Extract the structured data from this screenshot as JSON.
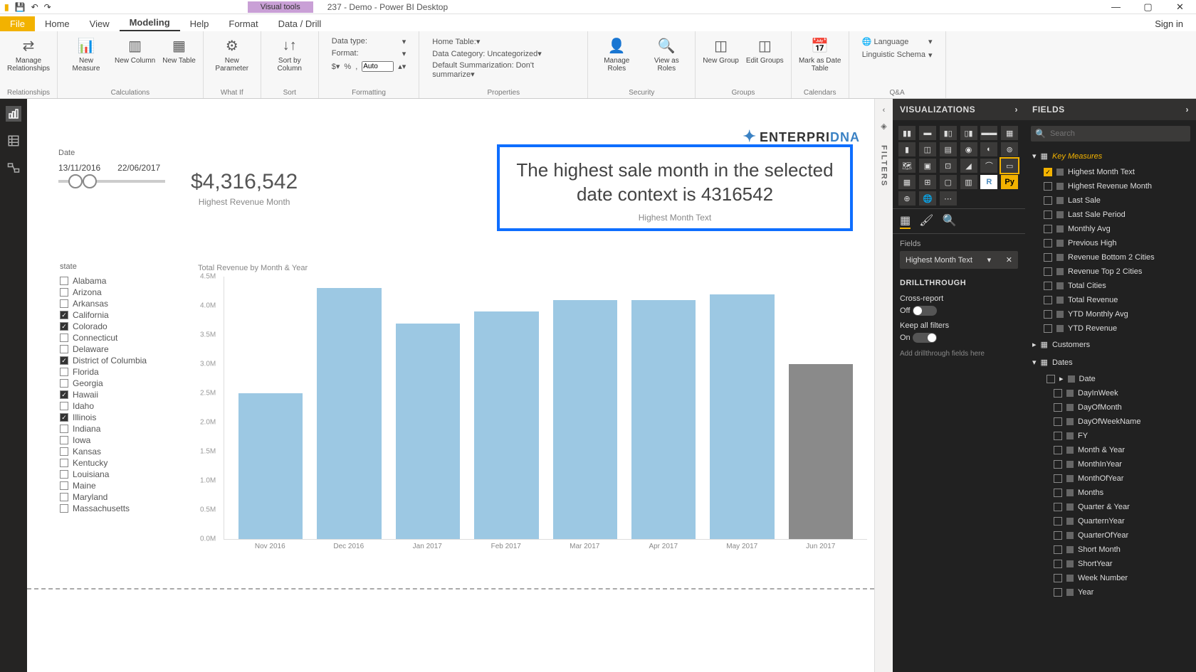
{
  "titlebar": {
    "title": "237 - Demo - Power BI Desktop",
    "vtools": "Visual tools",
    "signin": "Sign in"
  },
  "tabs": {
    "file": "File",
    "items": [
      "Home",
      "View",
      "Modeling",
      "Help",
      "Format",
      "Data / Drill"
    ],
    "active": "Modeling"
  },
  "ribbon": {
    "relationships": {
      "manage": "Manage\nRelationships",
      "group": "Relationships"
    },
    "calcs": {
      "measure": "New\nMeasure",
      "column": "New\nColumn",
      "table": "New\nTable",
      "group": "Calculations"
    },
    "whatif": {
      "param": "New\nParameter",
      "group": "What If"
    },
    "sort": {
      "btn": "Sort by\nColumn",
      "group": "Sort"
    },
    "formatting": {
      "datatype": "Data type:",
      "format": "Format:",
      "auto": "Auto",
      "group": "Formatting"
    },
    "props": {
      "hometable": "Home Table:",
      "datacat": "Data Category: Uncategorized",
      "summ": "Default Summarization: Don't summarize",
      "group": "Properties"
    },
    "security": {
      "manage": "Manage\nRoles",
      "view": "View as\nRoles",
      "group": "Security"
    },
    "groups": {
      "new": "New\nGroup",
      "edit": "Edit\nGroups",
      "group": "Groups"
    },
    "calendars": {
      "mark": "Mark as\nDate Table",
      "group": "Calendars"
    },
    "qa": {
      "lang": "Language",
      "ling": "Linguistic Schema",
      "group": "Q&A"
    }
  },
  "dateSlicer": {
    "label": "Date",
    "from": "13/11/2016",
    "to": "22/06/2017"
  },
  "card": {
    "value": "$4,316,542",
    "caption": "Highest Revenue Month"
  },
  "textVisual": {
    "text": "The highest sale month in the selected date context is 4316542",
    "caption": "Highest Month Text"
  },
  "states": {
    "label": "state",
    "items": [
      {
        "name": "Alabama",
        "checked": false
      },
      {
        "name": "Arizona",
        "checked": false
      },
      {
        "name": "Arkansas",
        "checked": false
      },
      {
        "name": "California",
        "checked": true
      },
      {
        "name": "Colorado",
        "checked": true
      },
      {
        "name": "Connecticut",
        "checked": false
      },
      {
        "name": "Delaware",
        "checked": false
      },
      {
        "name": "District of Columbia",
        "checked": true
      },
      {
        "name": "Florida",
        "checked": false
      },
      {
        "name": "Georgia",
        "checked": false
      },
      {
        "name": "Hawaii",
        "checked": true
      },
      {
        "name": "Idaho",
        "checked": false
      },
      {
        "name": "Illinois",
        "checked": true
      },
      {
        "name": "Indiana",
        "checked": false
      },
      {
        "name": "Iowa",
        "checked": false
      },
      {
        "name": "Kansas",
        "checked": false
      },
      {
        "name": "Kentucky",
        "checked": false
      },
      {
        "name": "Louisiana",
        "checked": false
      },
      {
        "name": "Maine",
        "checked": false
      },
      {
        "name": "Maryland",
        "checked": false
      },
      {
        "name": "Massachusetts",
        "checked": false
      }
    ]
  },
  "chart_data": {
    "type": "bar",
    "title": "Total Revenue by Month & Year",
    "ylabel": "",
    "xlabel": "",
    "ylim": [
      0,
      4500000
    ],
    "yticks": [
      "4.5M",
      "4.0M",
      "3.5M",
      "3.0M",
      "2.5M",
      "2.0M",
      "1.5M",
      "1.0M",
      "0.5M",
      "0.0M"
    ],
    "categories": [
      "Nov 2016",
      "Dec 2016",
      "Jan 2017",
      "Feb 2017",
      "Mar 2017",
      "Apr 2017",
      "May 2017",
      "Jun 2017"
    ],
    "values": [
      2500000,
      4300000,
      3700000,
      3900000,
      4100000,
      4100000,
      4200000,
      3000000
    ],
    "dimmed": [
      false,
      false,
      false,
      false,
      false,
      false,
      false,
      true
    ]
  },
  "logo": {
    "a": "ENTERPRI",
    "b": "DNA"
  },
  "vizPanel": {
    "header": "VISUALIZATIONS",
    "fieldsLabel": "Fields",
    "well": "Highest Month Text",
    "drill": "DRILLTHROUGH",
    "cross": "Cross-report",
    "off": "Off",
    "keep": "Keep all filters",
    "on": "On",
    "hint": "Add drillthrough fields here"
  },
  "fieldsPanel": {
    "header": "FIELDS",
    "search": "Search",
    "keyMeasures": {
      "name": "Key Measures",
      "items": [
        {
          "name": "Highest Month Text",
          "checked": true
        },
        {
          "name": "Highest Revenue Month",
          "checked": false
        },
        {
          "name": "Last Sale",
          "checked": false
        },
        {
          "name": "Last Sale Period",
          "checked": false
        },
        {
          "name": "Monthly Avg",
          "checked": false
        },
        {
          "name": "Previous High",
          "checked": false
        },
        {
          "name": "Revenue Bottom 2 Cities",
          "checked": false
        },
        {
          "name": "Revenue Top 2 Cities",
          "checked": false
        },
        {
          "name": "Total Cities",
          "checked": false
        },
        {
          "name": "Total Revenue",
          "checked": false
        },
        {
          "name": "YTD Monthly Avg",
          "checked": false
        },
        {
          "name": "YTD Revenue",
          "checked": false
        }
      ]
    },
    "tables": [
      {
        "name": "Customers",
        "expanded": false
      },
      {
        "name": "Dates",
        "expanded": true,
        "items": [
          "Date",
          "DayInWeek",
          "DayOfMonth",
          "DayOfWeekName",
          "FY",
          "Month & Year",
          "MonthInYear",
          "MonthOfYear",
          "Months",
          "Quarter & Year",
          "QuarternYear",
          "QuarterOfYear",
          "Short Month",
          "ShortYear",
          "Week Number",
          "Year"
        ]
      }
    ]
  }
}
